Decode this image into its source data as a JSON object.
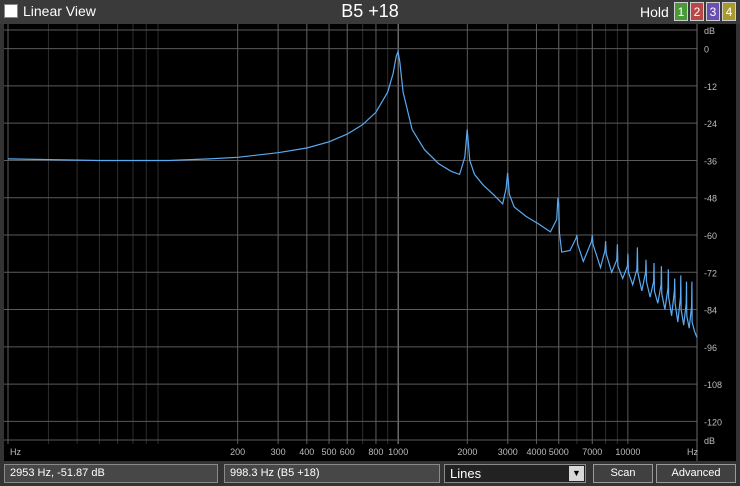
{
  "header": {
    "linear_view_label": "Linear View",
    "linear_view_checked": false,
    "title": "B5 +18",
    "hold_label": "Hold",
    "hold_buttons": [
      {
        "label": "1",
        "color": "#4a9a3a"
      },
      {
        "label": "2",
        "color": "#b84848"
      },
      {
        "label": "3",
        "color": "#6a4fb0"
      },
      {
        "label": "4",
        "color": "#a89a30"
      }
    ]
  },
  "chart_data": {
    "type": "line",
    "title": "B5 +18",
    "xlabel": "Hz",
    "ylabel": "dB",
    "x_scale": "log",
    "xlim": [
      20,
      20000
    ],
    "ylim": [
      -126,
      6
    ],
    "grid": true,
    "x_major_ticks": [
      {
        "value": 20,
        "label": "Hz"
      },
      {
        "value": 200,
        "label": "200"
      },
      {
        "value": 300,
        "label": "300"
      },
      {
        "value": 400,
        "label": "400"
      },
      {
        "value": 500,
        "label": "500"
      },
      {
        "value": 600,
        "label": "600"
      },
      {
        "value": 800,
        "label": "800"
      },
      {
        "value": 1000,
        "label": "1000"
      },
      {
        "value": 2000,
        "label": "2000"
      },
      {
        "value": 3000,
        "label": "3000"
      },
      {
        "value": 4000,
        "label": "4000"
      },
      {
        "value": 5000,
        "label": "5000"
      },
      {
        "value": 7000,
        "label": "7000"
      },
      {
        "value": 10000,
        "label": "10000"
      },
      {
        "value": 20000,
        "label": "Hz"
      }
    ],
    "y_ticks": [
      {
        "value": 6,
        "label": "dB"
      },
      {
        "value": 0,
        "label": "0"
      },
      {
        "value": -12,
        "label": "-12"
      },
      {
        "value": -24,
        "label": "-24"
      },
      {
        "value": -36,
        "label": "-36"
      },
      {
        "value": -48,
        "label": "-48"
      },
      {
        "value": -60,
        "label": "-60"
      },
      {
        "value": -72,
        "label": "-72"
      },
      {
        "value": -84,
        "label": "-84"
      },
      {
        "value": -96,
        "label": "-96"
      },
      {
        "value": -108,
        "label": "-108"
      },
      {
        "value": -120,
        "label": "-120"
      },
      {
        "value": -126,
        "label": "dB"
      }
    ],
    "series": [
      {
        "color": "#5aaaf0",
        "x": [
          20,
          50,
          100,
          150,
          200,
          300,
          400,
          500,
          600,
          700,
          800,
          900,
          950,
          980,
          998,
          1015,
          1050,
          1150,
          1300,
          1500,
          1700,
          1850,
          1950,
          1998,
          2050,
          2150,
          2350,
          2600,
          2850,
          2950,
          2995,
          3050,
          3200,
          3600,
          4100,
          4600,
          4900,
          4960,
          5000,
          5040,
          5150,
          5600,
          5950,
          6000,
          6050,
          6400,
          6950,
          7000,
          7050,
          7600,
          7950,
          8000,
          8050,
          8500,
          8950,
          9000,
          9050,
          9500,
          9950,
          10000,
          10050,
          10500,
          10950,
          11000,
          11050,
          11500,
          11950,
          12000,
          12050,
          12500,
          12950,
          13000,
          13050,
          13500,
          13950,
          14000,
          14050,
          14500,
          14950,
          15000,
          15050,
          15500,
          15950,
          16000,
          16050,
          16500,
          16950,
          17000,
          17050,
          17500,
          17950,
          18000,
          18050,
          18500,
          18950,
          19000,
          19050,
          19500,
          20000
        ],
        "y": [
          -35.5,
          -36,
          -36,
          -35.5,
          -35,
          -33.5,
          -32,
          -30,
          -27.5,
          -24.5,
          -20.5,
          -14,
          -8,
          -2.5,
          -1,
          -4,
          -14,
          -26,
          -32.5,
          -37,
          -39.5,
          -40.5,
          -35,
          -26,
          -36,
          -40.5,
          -44,
          -47,
          -50,
          -45,
          -40,
          -47,
          -51,
          -54,
          -56.5,
          -59,
          -55,
          -48,
          -50,
          -59.5,
          -65.5,
          -65,
          -61,
          -60,
          -63,
          -68.5,
          -62,
          -60,
          -63,
          -70.5,
          -65,
          -62,
          -66,
          -72,
          -68,
          -63,
          -70,
          -74,
          -70,
          -66,
          -72,
          -76,
          -71,
          -64,
          -72,
          -78,
          -72,
          -68,
          -75,
          -80,
          -75,
          -69,
          -78,
          -82,
          -76,
          -70,
          -79,
          -84,
          -77,
          -71,
          -80,
          -86,
          -78,
          -74,
          -82,
          -88,
          -80,
          -73,
          -84,
          -89,
          -82,
          -75,
          -86,
          -90,
          -83,
          -75,
          -88,
          -91,
          -93
        ]
      }
    ]
  },
  "status": {
    "cursor_readout": "2953 Hz, -51.87 dB",
    "pitch_readout": "998.3 Hz (B5 +18)",
    "display_mode": "Lines",
    "scan_label": "Scan",
    "advanced_label": "Advanced"
  },
  "colors": {
    "background": "#333333",
    "plot_background": "#000000",
    "grid": "#5a5a5a",
    "trace": "#5aaaf0"
  }
}
